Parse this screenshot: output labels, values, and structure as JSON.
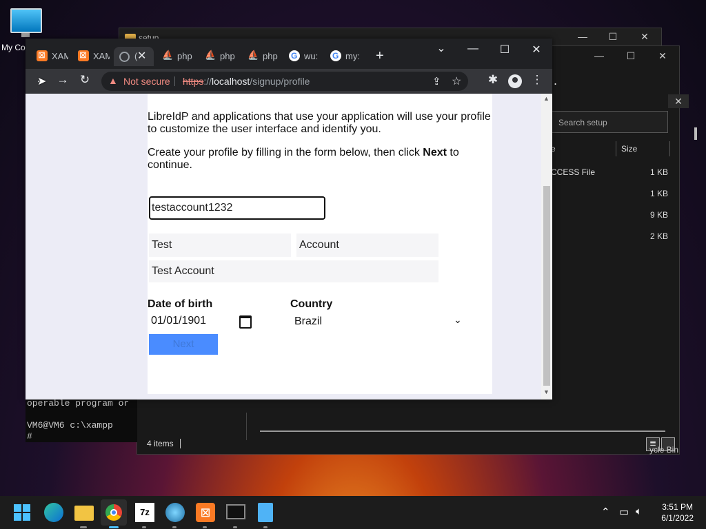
{
  "desktop": {
    "icon_label": "My Co"
  },
  "setup_window": {
    "title": "setup"
  },
  "explorer": {
    "search_placeholder": "Search setup",
    "col_name": "e",
    "col_size": "Size",
    "rows": [
      {
        "name": "CCESS File",
        "size": "1 KB"
      },
      {
        "name": "",
        "size": "1 KB"
      },
      {
        "name": "",
        "size": "9 KB"
      },
      {
        "name": "",
        "size": "2 KB"
      }
    ],
    "status": "4 items",
    "partial_text": ".",
    "recycle": "ycle Bin"
  },
  "terminal": {
    "line1": "operable program or",
    "line2": "VM6@VM6 c:\\xampp",
    "line3": "#"
  },
  "browser": {
    "tabs": [
      {
        "label": "XAM",
        "icon": "xampp-icon"
      },
      {
        "label": "XAM",
        "icon": "xampp-icon"
      },
      {
        "label": "(",
        "icon": "globe-icon",
        "active": true
      },
      {
        "label": "php",
        "icon": "phpmyadmin-icon"
      },
      {
        "label": "php",
        "icon": "phpmyadmin-icon"
      },
      {
        "label": "php",
        "icon": "phpmyadmin-icon"
      },
      {
        "label": "wu:",
        "icon": "google-icon"
      },
      {
        "label": "my:",
        "icon": "google-icon"
      }
    ],
    "new_tab": "+",
    "security": "Not secure",
    "url_scheme": "https",
    "url_sep": "://",
    "url_host": "localhost",
    "url_path": "/signup/profile"
  },
  "page": {
    "intro": "LibreIdP and applications that use your application will use your profile to customize the user interface and identify you.",
    "instruction_pre": "Create your profile by filling in the form below, then click ",
    "instruction_bold": "Next",
    "instruction_post": " to continue.",
    "username_value": "testaccount1232",
    "first_name_value": "Test",
    "last_name_value": "Account",
    "display_name_value": "Test Account",
    "dob_label": "Date of birth",
    "dob_value": "01/01/1901",
    "country_label": "Country",
    "country_value": "Brazil",
    "next_label": "Next"
  },
  "taskbar": {
    "time": "3:51 PM",
    "date": "6/1/2022"
  }
}
